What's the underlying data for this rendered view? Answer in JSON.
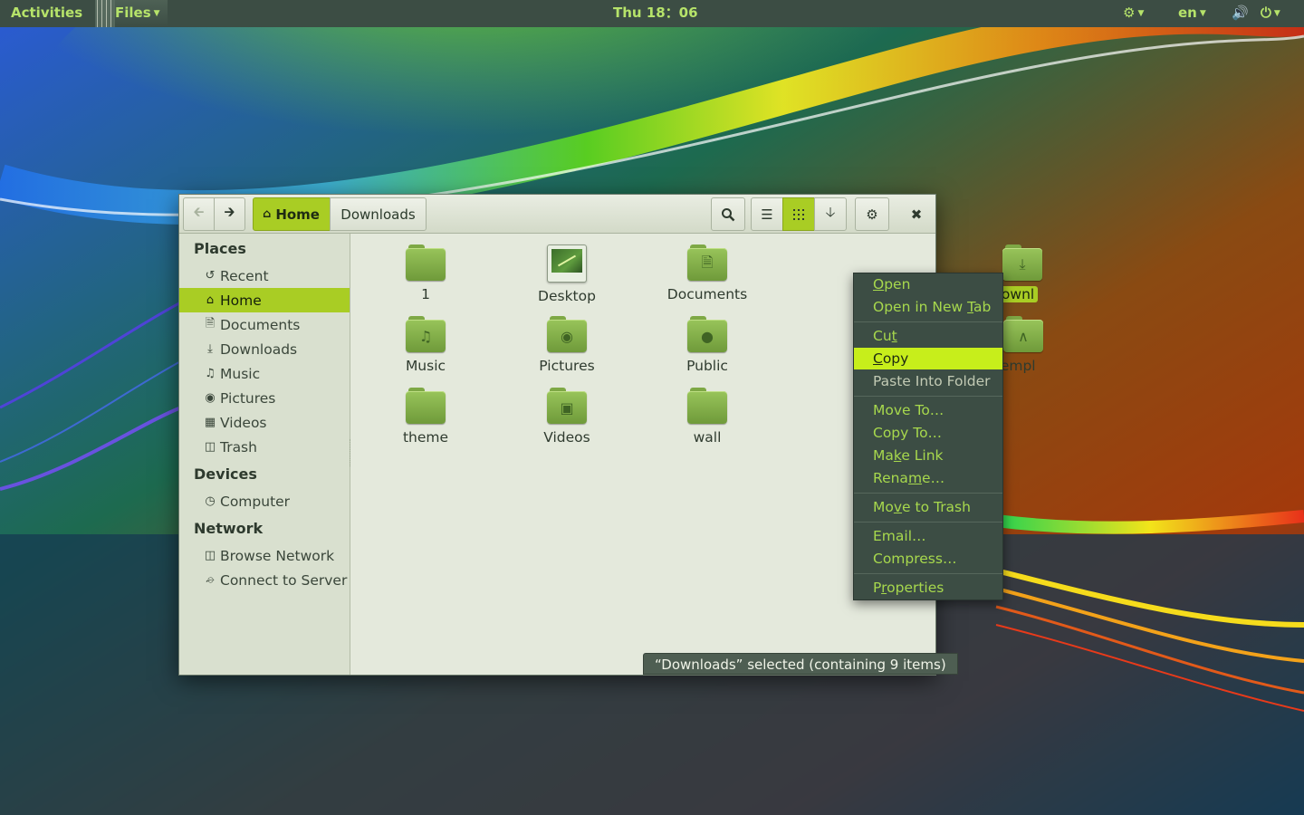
{
  "topbar": {
    "activities": "Activities",
    "app_menu": "Files",
    "clock": "Thu 18：06",
    "lang": "en"
  },
  "window": {
    "breadcrumb": {
      "home": "Home",
      "current": "Downloads"
    },
    "sidebar": {
      "places_header": "Places",
      "places": [
        {
          "label": "Recent",
          "icon": "recent-icon"
        },
        {
          "label": "Home",
          "icon": "home-icon",
          "active": true
        },
        {
          "label": "Documents",
          "icon": "document-icon"
        },
        {
          "label": "Downloads",
          "icon": "download-icon"
        },
        {
          "label": "Music",
          "icon": "music-icon"
        },
        {
          "label": "Pictures",
          "icon": "camera-icon"
        },
        {
          "label": "Videos",
          "icon": "film-icon"
        },
        {
          "label": "Trash",
          "icon": "trash-icon"
        }
      ],
      "devices_header": "Devices",
      "devices": [
        {
          "label": "Computer",
          "icon": "drive-icon"
        }
      ],
      "network_header": "Network",
      "network": [
        {
          "label": "Browse Network",
          "icon": "network-icon"
        },
        {
          "label": "Connect to Server",
          "icon": "server-icon"
        }
      ]
    },
    "files": [
      {
        "name": "1",
        "icon": "folder-icon"
      },
      {
        "name": "Desktop",
        "icon": "desktop-folder-icon"
      },
      {
        "name": "Documents",
        "icon": "documents-folder-icon"
      },
      {
        "name": "Downl",
        "icon": "downloads-folder-icon",
        "selected": true
      },
      {
        "name": "Music",
        "icon": "music-folder-icon"
      },
      {
        "name": "Pictures",
        "icon": "pictures-folder-icon"
      },
      {
        "name": "Public",
        "icon": "public-folder-icon"
      },
      {
        "name": "Templ",
        "icon": "templates-folder-icon"
      },
      {
        "name": "theme",
        "icon": "folder-icon"
      },
      {
        "name": "Videos",
        "icon": "videos-folder-icon"
      },
      {
        "name": "wall",
        "icon": "folder-icon"
      }
    ],
    "status": "“Downloads” selected  (containing 9 items)"
  },
  "context_menu": {
    "items": [
      {
        "label": "Open",
        "accel": "O"
      },
      {
        "label": "Open in New Tab",
        "accel": "T"
      },
      {
        "label": "Cut",
        "accel": "t"
      },
      {
        "label": "Copy",
        "accel": "C",
        "highlighted": true
      },
      {
        "label": "Paste Into Folder",
        "disabled": true
      },
      {
        "label": "Move To…"
      },
      {
        "label": "Copy To…"
      },
      {
        "label": "Make Link",
        "accel": "k"
      },
      {
        "label": "Rename…",
        "accel": "m"
      },
      {
        "label": "Move to Trash",
        "accel": "v"
      },
      {
        "label": "Email…"
      },
      {
        "label": "Compress…"
      },
      {
        "label": "Properties",
        "accel": "r"
      }
    ]
  },
  "colors": {
    "accent": "#a9cd24",
    "menu_highlight": "#c7ee1b",
    "panel_bg": "#3c4d44",
    "menu_text": "#a7d84d"
  }
}
